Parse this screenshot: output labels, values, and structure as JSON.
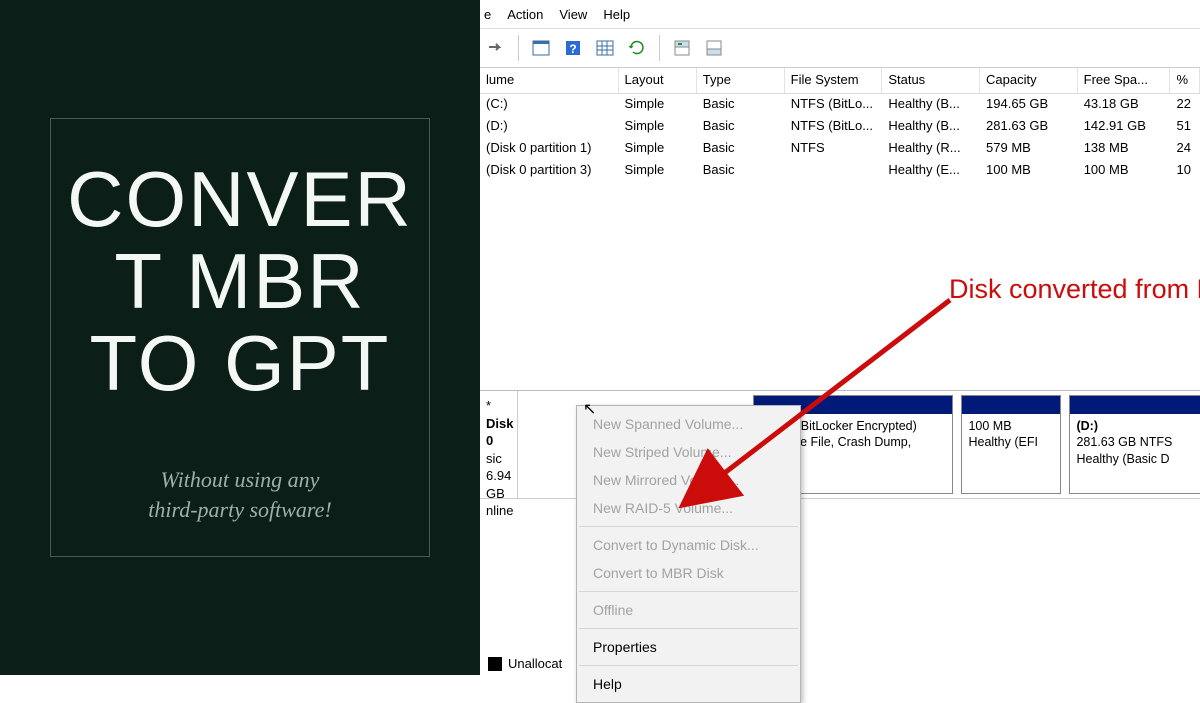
{
  "promo": {
    "title_line1": "CONVER",
    "title_line2": "T MBR",
    "title_line3": "TO GPT",
    "subtitle_line1": "Without using any",
    "subtitle_line2": "third-party software!"
  },
  "menubar": {
    "file_partial": "e",
    "action": "Action",
    "view": "View",
    "help": "Help"
  },
  "headers": {
    "volume": "lume",
    "layout": "Layout",
    "type": "Type",
    "fs": "File System",
    "status": "Status",
    "capacity": "Capacity",
    "free": "Free Spa...",
    "pct": "%"
  },
  "rows": [
    {
      "vol": "(C:)",
      "layout": "Simple",
      "type": "Basic",
      "fs": "NTFS (BitLo...",
      "status": "Healthy (B...",
      "cap": "194.65 GB",
      "free": "43.18 GB",
      "pct": "22"
    },
    {
      "vol": "(D:)",
      "layout": "Simple",
      "type": "Basic",
      "fs": "NTFS (BitLo...",
      "status": "Healthy (B...",
      "cap": "281.63 GB",
      "free": "142.91 GB",
      "pct": "51"
    },
    {
      "vol": "(Disk 0 partition 1)",
      "layout": "Simple",
      "type": "Basic",
      "fs": "NTFS",
      "status": "Healthy (R...",
      "cap": "579 MB",
      "free": "138 MB",
      "pct": "24"
    },
    {
      "vol": "(Disk 0 partition 3)",
      "layout": "Simple",
      "type": "Basic",
      "fs": "",
      "status": "Healthy (E...",
      "cap": "100 MB",
      "free": "100 MB",
      "pct": "10"
    }
  ],
  "disk": {
    "name": "Disk 0",
    "type_partial": "sic",
    "size_partial": "6.94 GB",
    "status_partial": "nline",
    "parts": [
      {
        "line1": "",
        "line2": "NTFS (BitLocker Encrypted)",
        "line3": "ot, Page File, Crash Dump,"
      },
      {
        "line1": "",
        "line2": "100 MB",
        "line3": "Healthy (EFI"
      },
      {
        "title": "(D:)",
        "line2": "281.63 GB NTFS",
        "line3": "Healthy (Basic D"
      }
    ]
  },
  "legend": {
    "unalloc": "Unallocat"
  },
  "ctx": {
    "new_spanned": "New Spanned Volume...",
    "new_striped": "New Striped Volume...",
    "new_mirrored": "New Mirrored Volume...",
    "new_raid5": "New RAID-5 Volume...",
    "conv_dyn": "Convert to Dynamic Disk...",
    "conv_mbr": "Convert to MBR Disk",
    "offline": "Offline",
    "properties": "Properties",
    "help": "Help"
  },
  "annotation": {
    "text": "Disk converted from MBR"
  }
}
